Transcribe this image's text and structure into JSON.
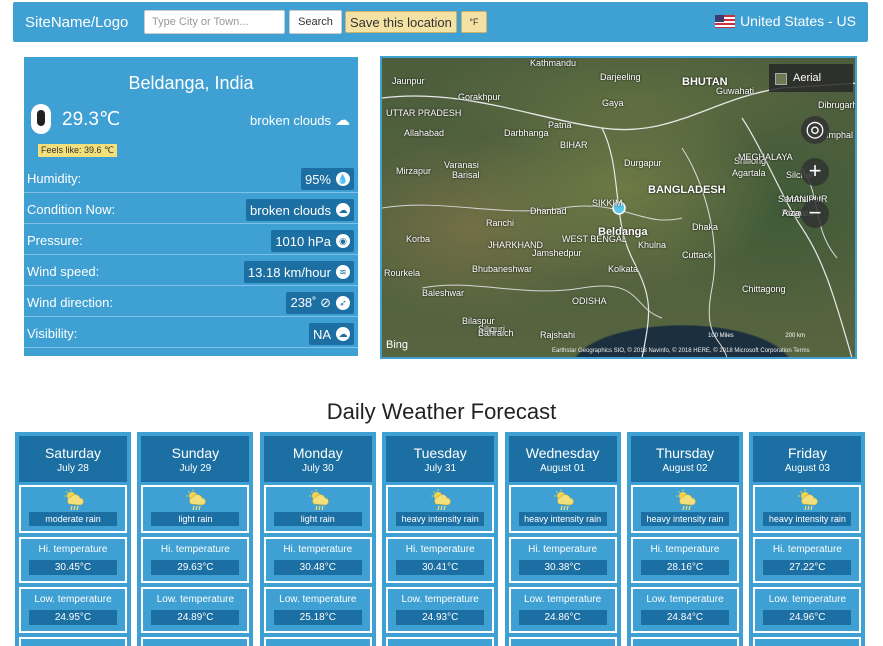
{
  "nav": {
    "logo": "SiteName/Logo",
    "search_placeholder": "Type City or Town...",
    "search_button": "Search",
    "save_button": "Save this location",
    "unit_button": "°F",
    "country": "United States - US"
  },
  "current": {
    "city": "Beldanga, India",
    "temperature": "29.3℃",
    "description": "broken clouds",
    "feels_like": "Feels like: 39.6 ℃",
    "rows": [
      {
        "label": "Humidity:",
        "value": "95%",
        "icon": "humidity-icon"
      },
      {
        "label": "Condition Now:",
        "value": "broken clouds",
        "icon": "cloud-icon"
      },
      {
        "label": "Pressure:",
        "value": "1010 hPa",
        "icon": "pressure-gauge-icon"
      },
      {
        "label": "Wind speed:",
        "value": "13.18 km/hour",
        "icon": "wind-icon"
      },
      {
        "label": "Wind direction:",
        "value": "238˚ ⊘",
        "icon": "compass-arrow-icon"
      },
      {
        "label": "Visibility:",
        "value": "NA",
        "icon": "visibility-cloud-icon"
      }
    ]
  },
  "map": {
    "aerial": "Aerial",
    "bing": "Bing",
    "attribution": "Earthstar Geographics SIO, © 2018 Navinfo, © 2018 HERE, © 2018 Microsoft Corporation Terms",
    "scale_left": "100 Miles",
    "scale_right": "200 km",
    "labels": [
      {
        "text": "BHUTAN",
        "big": true
      },
      {
        "text": "BANGLADESH",
        "big": true
      },
      {
        "text": "Beldanga",
        "big": true
      },
      {
        "text": "Kathmandu"
      },
      {
        "text": "Gorakhpur"
      },
      {
        "text": "UTTAR PRADESH"
      },
      {
        "text": "Varanasi"
      },
      {
        "text": "Mirzapur"
      },
      {
        "text": "Patna"
      },
      {
        "text": "Darbhanga"
      },
      {
        "text": "BIHAR"
      },
      {
        "text": "Ranchi"
      },
      {
        "text": "JHARKHAND"
      },
      {
        "text": "Dhanbad"
      },
      {
        "text": "Durgapur"
      },
      {
        "text": "WEST BENGAL"
      },
      {
        "text": "Jamshedpur"
      },
      {
        "text": "Kolkata"
      },
      {
        "text": "Khulna"
      },
      {
        "text": "Dhaka"
      },
      {
        "text": "Guwahati"
      },
      {
        "text": "Shillong"
      },
      {
        "text": "MEGHALAYA"
      },
      {
        "text": "Agartala"
      },
      {
        "text": "Chittagong"
      },
      {
        "text": "Silchar"
      },
      {
        "text": "Imphal"
      },
      {
        "text": "Sambalpur"
      },
      {
        "text": "Raigarh"
      },
      {
        "text": "Bilaspur"
      },
      {
        "text": "Rourkela"
      },
      {
        "text": "Baleshwar"
      },
      {
        "text": "Bhubaneshwar"
      },
      {
        "text": "ODISHA"
      },
      {
        "text": "Rajshahi"
      },
      {
        "text": "Siliguri"
      },
      {
        "text": "SIKKIM"
      },
      {
        "text": "Darjeeling"
      },
      {
        "text": "Gaya"
      },
      {
        "text": "Barisal"
      },
      {
        "text": "Cuttack"
      },
      {
        "text": "Bahraich"
      },
      {
        "text": "Jaunpur"
      },
      {
        "text": "Allahabad"
      },
      {
        "text": "Korba"
      },
      {
        "text": "Dibrugarh"
      },
      {
        "text": "MANIPUR"
      },
      {
        "text": "Aizawl"
      }
    ]
  },
  "forecast": {
    "title": "Daily Weather Forecast",
    "hi_label": "Hi. temperature",
    "lo_label": "Low. temperature",
    "days": [
      {
        "day": "Saturday",
        "date": "July 28",
        "condition": "moderate rain",
        "hi": "30.45°C",
        "lo": "24.95°C"
      },
      {
        "day": "Sunday",
        "date": "July 29",
        "condition": "light rain",
        "hi": "29.63°C",
        "lo": "24.89°C"
      },
      {
        "day": "Monday",
        "date": "July 30",
        "condition": "light rain",
        "hi": "30.48°C",
        "lo": "25.18°C"
      },
      {
        "day": "Tuesday",
        "date": "July 31",
        "condition": "heavy intensity rain",
        "hi": "30.41°C",
        "lo": "24.93°C"
      },
      {
        "day": "Wednesday",
        "date": "August 01",
        "condition": "heavy intensity rain",
        "hi": "30.38°C",
        "lo": "24.86°C"
      },
      {
        "day": "Thursday",
        "date": "August 02",
        "condition": "heavy intensity rain",
        "hi": "28.16°C",
        "lo": "24.84°C"
      },
      {
        "day": "Friday",
        "date": "August 03",
        "condition": "heavy intensity rain",
        "hi": "27.22°C",
        "lo": "24.96°C"
      }
    ]
  }
}
